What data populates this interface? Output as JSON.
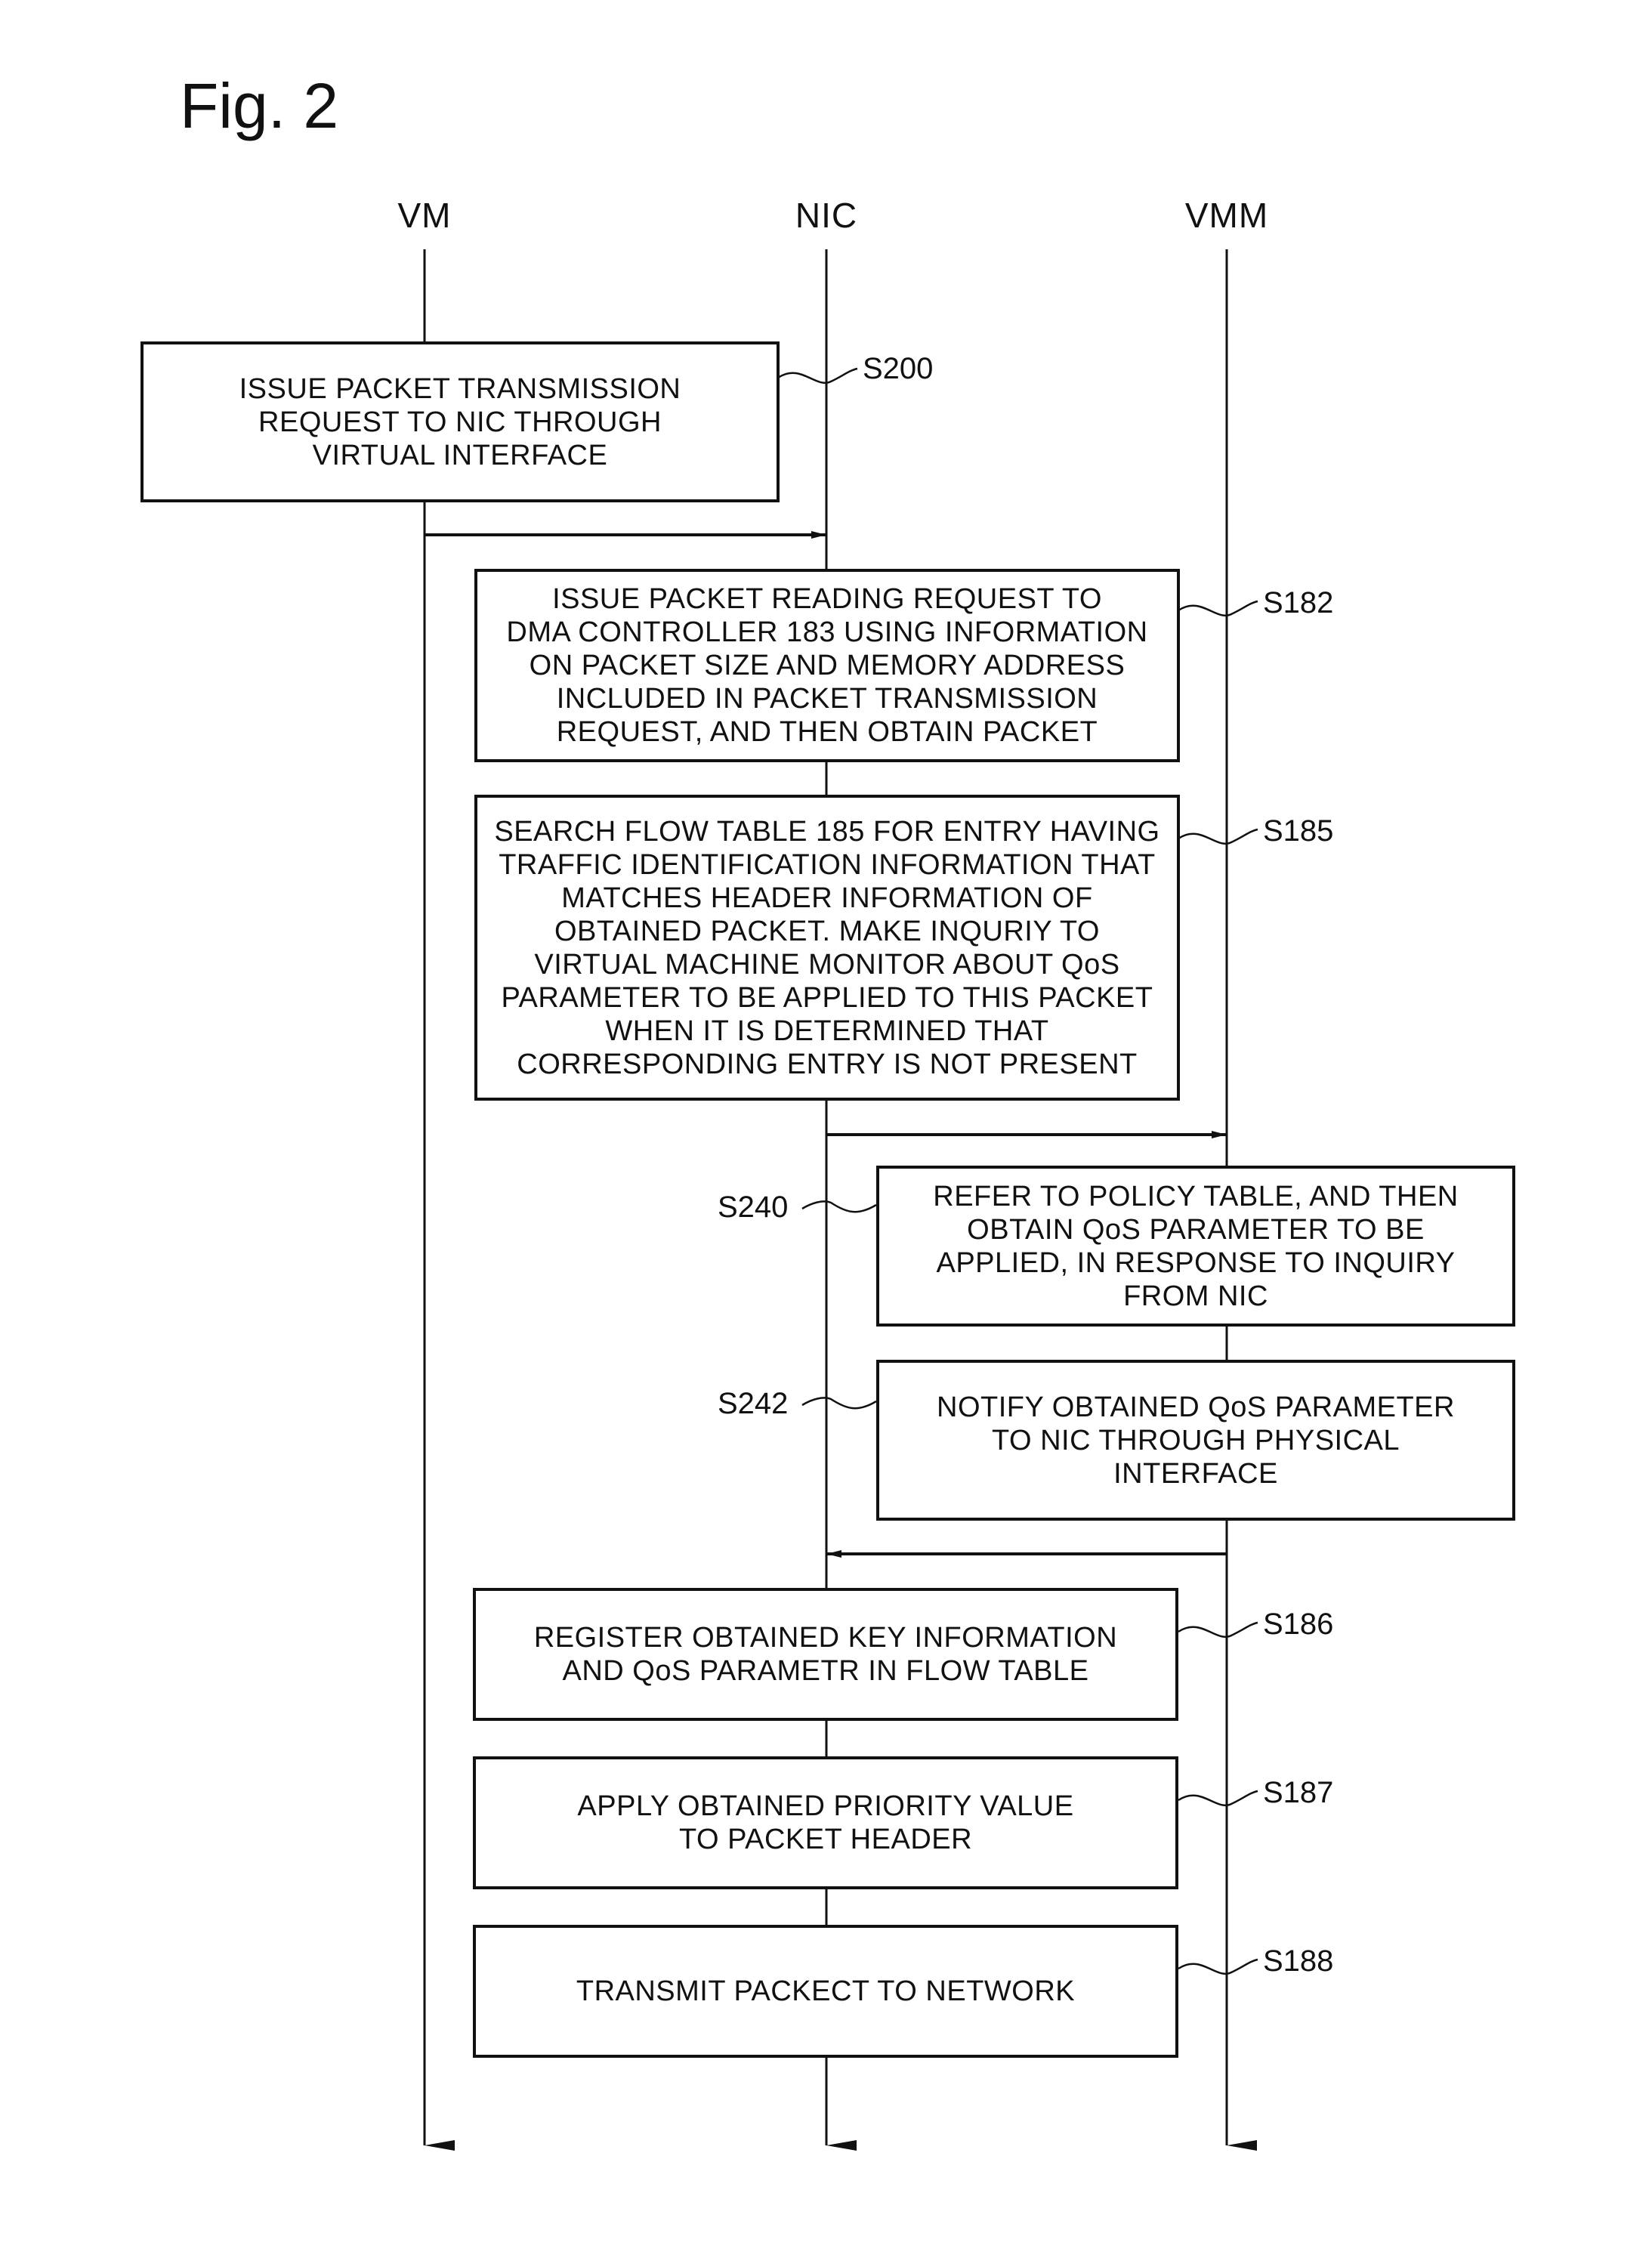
{
  "figure": {
    "title": "Fig. 2"
  },
  "lanes": [
    {
      "id": "vm",
      "label": "VM"
    },
    {
      "id": "nic",
      "label": "NIC"
    },
    {
      "id": "vmm",
      "label": "VMM"
    }
  ],
  "steps": [
    {
      "id": "S200",
      "label": "S200",
      "lane": "vm",
      "text": "ISSUE PACKET TRANSMISSION\nREQUEST TO NIC THROUGH\nVIRTUAL INTERFACE"
    },
    {
      "id": "S182",
      "label": "S182",
      "lane": "nic",
      "text": "ISSUE PACKET READING REQUEST TO\nDMA CONTROLLER 183 USING INFORMATION\nON PACKET SIZE AND MEMORY ADDRESS\nINCLUDED IN PACKET TRANSMISSION\nREQUEST, AND THEN OBTAIN PACKET"
    },
    {
      "id": "S185",
      "label": "S185",
      "lane": "nic",
      "text": "SEARCH FLOW TABLE 185 FOR ENTRY HAVING\nTRAFFIC IDENTIFICATION INFORMATION THAT\nMATCHES HEADER INFORMATION OF\nOBTAINED PACKET.  MAKE INQURIY TO\nVIRTUAL MACHINE MONITOR ABOUT QoS\nPARAMETER TO BE APPLIED TO THIS PACKET\nWHEN IT IS DETERMINED THAT\nCORRESPONDING ENTRY IS NOT PRESENT"
    },
    {
      "id": "S240",
      "label": "S240",
      "lane": "vmm",
      "text": "REFER TO POLICY TABLE, AND THEN\nOBTAIN QoS PARAMETER TO BE\nAPPLIED, IN RESPONSE TO INQUIRY\nFROM NIC"
    },
    {
      "id": "S242",
      "label": "S242",
      "lane": "vmm",
      "text": "NOTIFY OBTAINED QoS PARAMETER\nTO NIC THROUGH PHYSICAL\nINTERFACE"
    },
    {
      "id": "S186",
      "label": "S186",
      "lane": "nic",
      "text": "REGISTER OBTAINED KEY INFORMATION\nAND QoS PARAMETR IN FLOW TABLE"
    },
    {
      "id": "S187",
      "label": "S187",
      "lane": "nic",
      "text": "APPLY OBTAINED PRIORITY VALUE\nTO PACKET HEADER"
    },
    {
      "id": "S188",
      "label": "S188",
      "lane": "nic",
      "text": "TRANSMIT PACKECT TO NETWORK"
    }
  ],
  "messages": [
    {
      "from": "vm",
      "to": "nic",
      "after": "S200"
    },
    {
      "from": "nic",
      "to": "vmm",
      "after": "S185"
    },
    {
      "from": "vmm",
      "to": "nic",
      "after": "S242"
    }
  ]
}
